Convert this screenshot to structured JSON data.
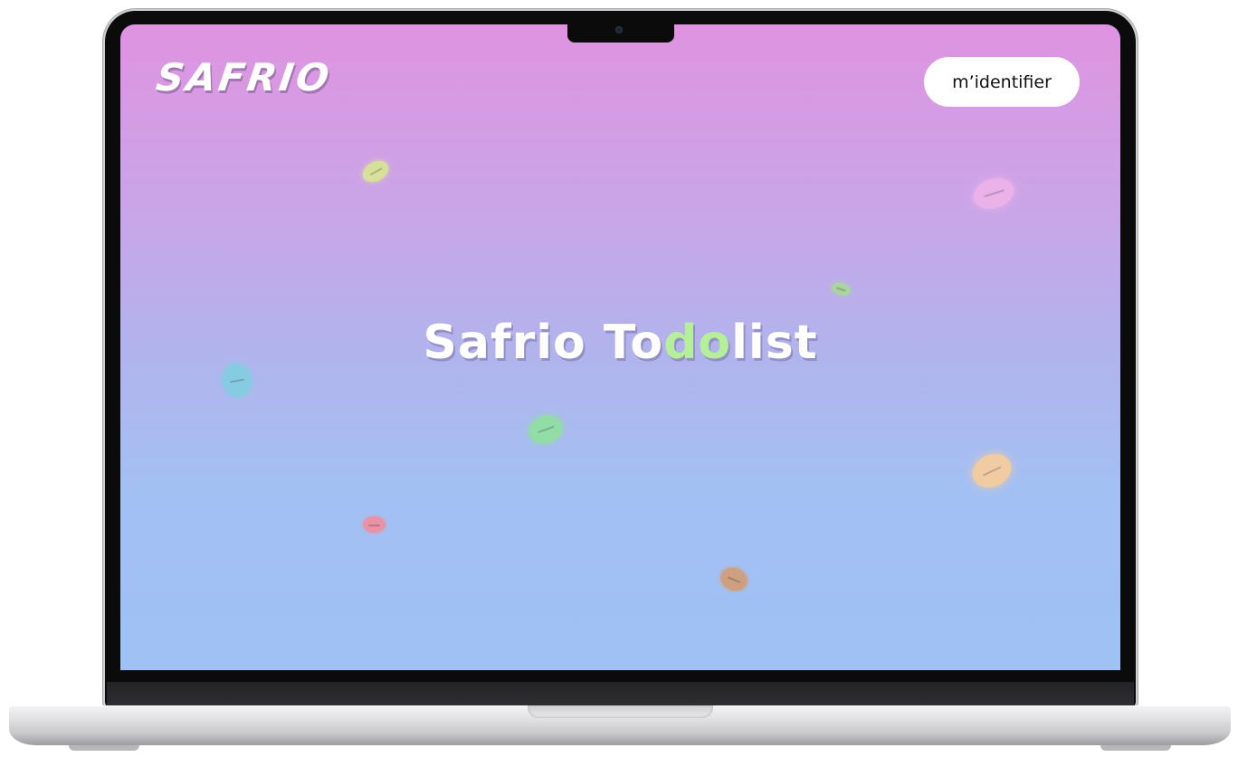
{
  "header": {
    "logo_text": "SAFRIO",
    "login_label": "m’identifier"
  },
  "hero": {
    "title_part1": "Safrio To",
    "title_highlight": "do",
    "title_part2": "list"
  },
  "decorations": {
    "pill_colors": [
      "#d9ec8f",
      "#f0b5ea",
      "#a7dd8f",
      "#80cfe0",
      "#8ee39a",
      "#ffcf96",
      "#f48a98",
      "#d79a6c"
    ]
  },
  "colors": {
    "gradient_top": "#df93e0",
    "gradient_bottom": "#9fc1f4",
    "highlight": "#b6ef9a"
  }
}
